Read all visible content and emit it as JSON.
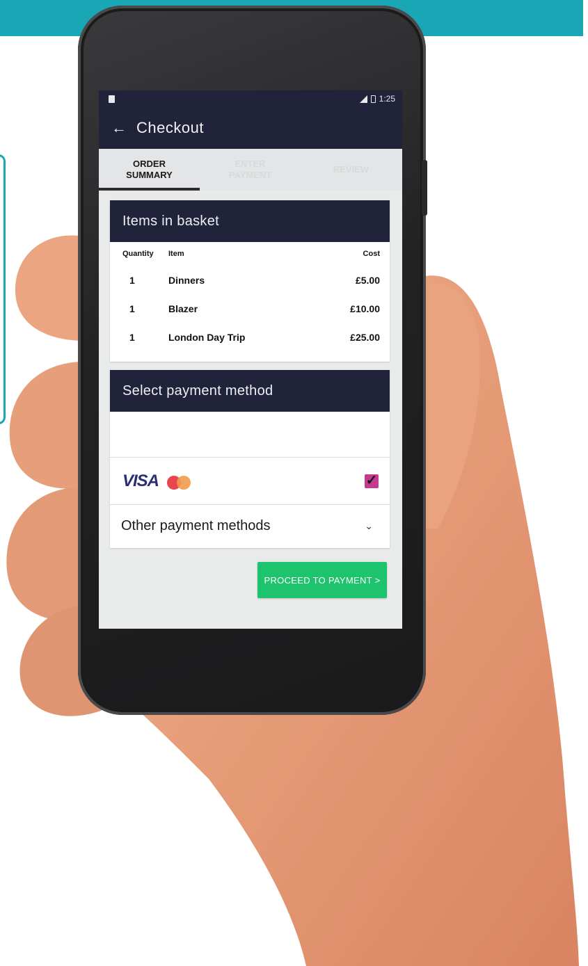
{
  "status_bar": {
    "time": "1:25"
  },
  "app_bar": {
    "back_icon": "arrow-left-icon",
    "title": "Checkout"
  },
  "tabs": [
    {
      "line1": "Order",
      "line2": "Summary",
      "active": true
    },
    {
      "line1": "Enter",
      "line2": "Payment",
      "active": false
    },
    {
      "line1": "Review",
      "line2": "",
      "active": false
    }
  ],
  "basket": {
    "title": "Items in basket",
    "columns": {
      "quantity": "Quantity",
      "item": "Item",
      "cost": "Cost"
    },
    "rows": [
      {
        "quantity": "1",
        "item": "Dinners",
        "cost": "£5.00"
      },
      {
        "quantity": "1",
        "item": "Blazer",
        "cost": "£10.00"
      },
      {
        "quantity": "1",
        "item": "London Day Trip",
        "cost": "£25.00"
      }
    ]
  },
  "payment": {
    "title": "Select payment method",
    "card_option": {
      "brand": "VISA",
      "logos": [
        "visa-logo",
        "mastercard-logo"
      ],
      "selected": true
    },
    "other_methods_label": "Other payment methods"
  },
  "proceed_button": {
    "label": "PROCEED TO PAYMENT >"
  },
  "colors": {
    "header_navy": "#20233a",
    "accent_teal": "#1aa7b5",
    "proceed_green": "#1ec46d"
  }
}
